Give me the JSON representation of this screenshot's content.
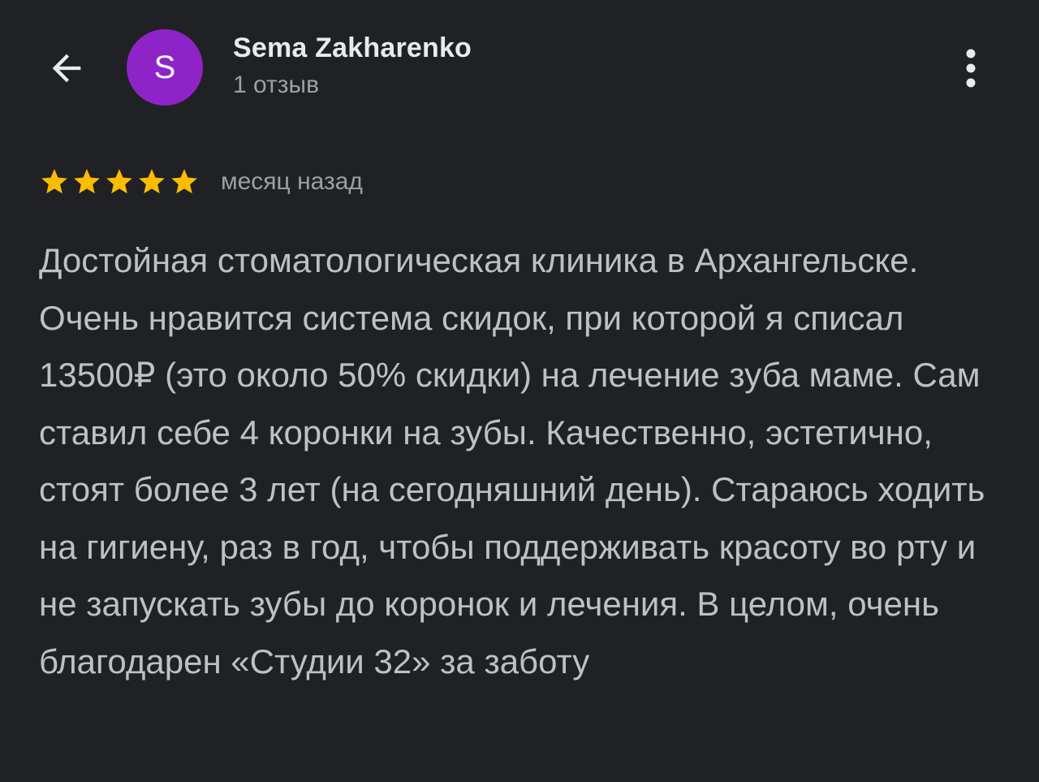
{
  "header": {
    "user_name": "Sema Zakharenko",
    "review_count": "1 отзыв",
    "avatar_letter": "S",
    "avatar_color": "#8e24c8",
    "back_icon": "arrow-left-icon",
    "menu_icon": "more-vertical-icon"
  },
  "review": {
    "rating": 5,
    "rating_max": 5,
    "star_color": "#fbbc04",
    "date": "месяц назад",
    "text": "Достойная стоматологическая клиника в Архангельске. Очень нравится система скидок, при которой я списал 13500₽ (это около 50% скидки) на лечение зуба маме. Сам ставил себе 4 коронки на зубы. Качественно, эстетично, стоят более 3 лет (на сегодняшний день). Стараюсь ходить на гигиену, раз в год, чтобы поддерживать красоту во рту и не запускать зубы до коронок и лечения. В целом, очень благодарен «Студии 32» за заботу"
  }
}
